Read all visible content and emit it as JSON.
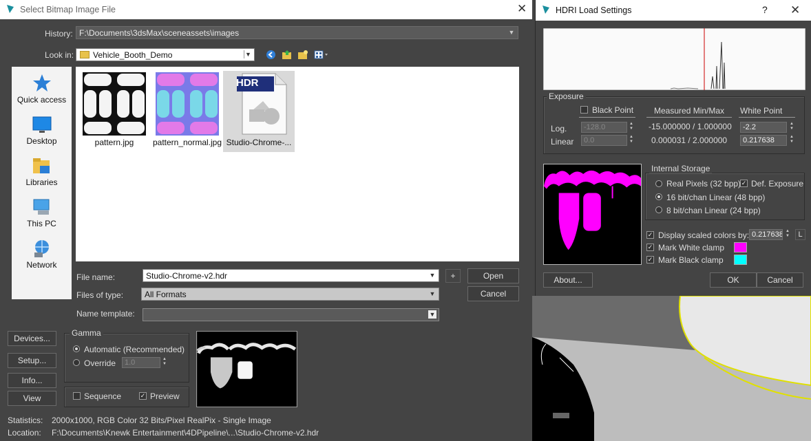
{
  "left_dialog": {
    "title": "Select Bitmap Image File",
    "history_label": "History:",
    "history_value": "F:\\Documents\\3dsMax\\sceneassets\\images",
    "lookin_label": "Look in:",
    "lookin_value": "Vehicle_Booth_Demo",
    "places": [
      {
        "label": "Quick access",
        "icon": "star-icon"
      },
      {
        "label": "Desktop",
        "icon": "desktop-icon"
      },
      {
        "label": "Libraries",
        "icon": "libraries-icon"
      },
      {
        "label": "This PC",
        "icon": "computer-icon"
      },
      {
        "label": "Network",
        "icon": "network-icon"
      }
    ],
    "files": [
      {
        "name": "pattern.jpg"
      },
      {
        "name": "pattern_normal.jpg"
      },
      {
        "name": "Studio-Chrome-...",
        "badge": "HDR"
      }
    ],
    "filename_label": "File name:",
    "filename_value": "Studio-Chrome-v2.hdr",
    "filetype_label": "Files of type:",
    "filetype_value": "All Formats",
    "template_label": "Name template:",
    "template_value": "",
    "plus_label": "+",
    "open_label": "Open",
    "cancel_label": "Cancel",
    "devices_label": "Devices...",
    "setup_label": "Setup...",
    "info_label": "Info...",
    "view_label": "View",
    "gamma": {
      "title": "Gamma",
      "automatic_label": "Automatic (Recommended)",
      "override_label": "Override",
      "override_value": "1.0"
    },
    "sequence_label": "Sequence",
    "preview_label": "Preview",
    "statistics_label": "Statistics:",
    "statistics_value": "2000x1000, RGB Color 32 Bits/Pixel RealPix - Single Image",
    "location_label": "Location:",
    "location_value": "F:\\Documents\\Knewk Entertainment\\4DPipeline\\...\\Studio-Chrome-v2.hdr"
  },
  "right_dialog": {
    "title": "HDRI Load Settings",
    "help_label": "?",
    "exposure_title": "Exposure",
    "black_point_label": "Black Point",
    "measured_label": "Measured Min/Max",
    "white_point_label": "White Point",
    "log_label": "Log.",
    "linear_label": "Linear",
    "black_log": "-128.0",
    "black_linear": "0.0",
    "measured_log": "-15.000000 / 1.000000",
    "measured_linear": "0.000031 / 2.000000",
    "white_log": "-2.2",
    "white_linear": "0.217638",
    "storage_title": "Internal Storage",
    "real_pixels_label": "Real Pixels (32 bpp)",
    "def_exposure_label": "Def. Exposure",
    "bit16_label": "16 bit/chan Linear (48 bpp)",
    "bit8_label": "8 bit/chan Linear (24 bpp)",
    "display_scaled_label": "Display scaled colors by:",
    "display_scaled_value": "0.217638",
    "l_label": "L",
    "white_clamp_label": "Mark White clamp",
    "black_clamp_label": "Mark Black clamp",
    "white_clamp_color": "#ff00ff",
    "black_clamp_color": "#00ffff",
    "about_label": "About...",
    "ok_label": "OK",
    "cancel_label": "Cancel"
  }
}
